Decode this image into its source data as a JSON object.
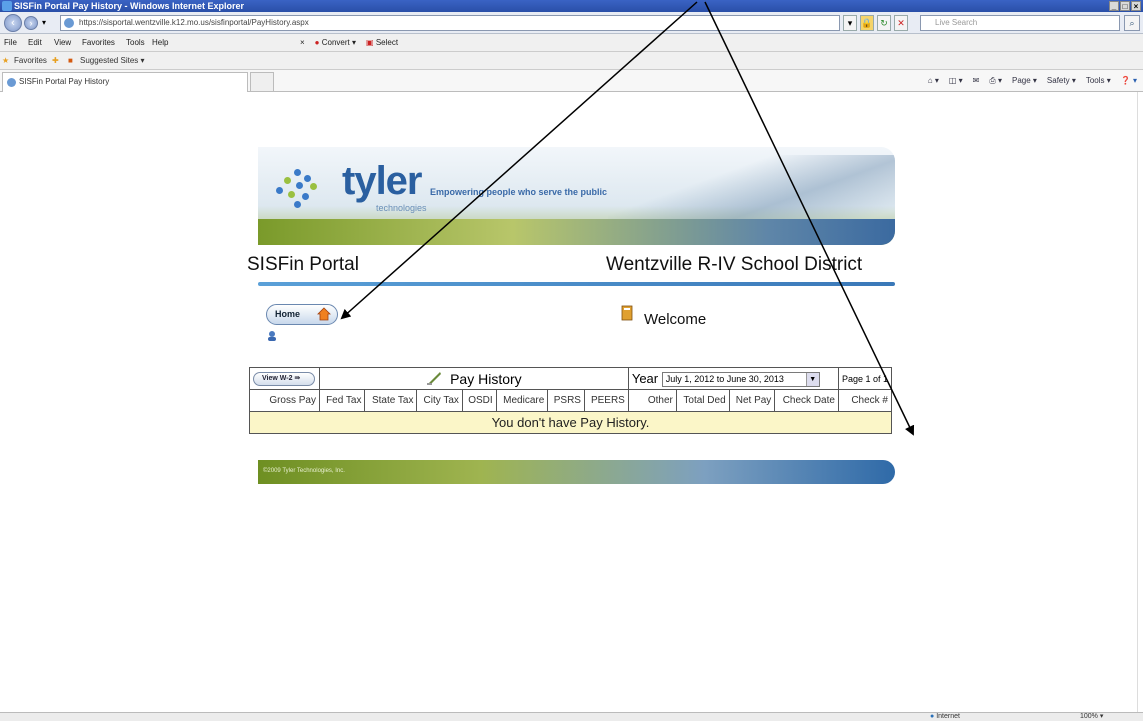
{
  "window": {
    "title": "SISFin Portal Pay History - Windows Internet Explorer",
    "url": "https://sisportal.wentzville.k12.mo.us/sisfinportal/PayHistory.aspx",
    "search_placeholder": "Live Search"
  },
  "menu": {
    "items": [
      "File",
      "Edit",
      "View",
      "Favorites",
      "Tools",
      "Help"
    ],
    "convert": "Convert",
    "select": "Select"
  },
  "favorites": {
    "label": "Favorites",
    "suggested": "Suggested Sites"
  },
  "tab": {
    "label": "SISFin Portal Pay History"
  },
  "commandbar": {
    "page": "Page",
    "safety": "Safety",
    "tools": "Tools"
  },
  "banner": {
    "logo": "tyler",
    "logo_sub": "technologies",
    "tagline": "Empowering people who serve the public"
  },
  "header": {
    "portal_title": "SISFin Portal",
    "district": "Wentzville R-IV School District"
  },
  "nav": {
    "home": "Home",
    "welcome": "Welcome"
  },
  "pay_history": {
    "view_w2": "View W-2",
    "title": "Pay History",
    "year_label": "Year",
    "year_value": "July 1, 2012 to June 30, 2013",
    "page_info": "Page 1 of 1",
    "columns": [
      "Gross Pay",
      "Fed Tax",
      "State Tax",
      "City Tax",
      "OSDI",
      "Medicare",
      "PSRS",
      "PEERS",
      "Other",
      "Total Ded",
      "Net Pay",
      "Check Date",
      "Check #"
    ],
    "empty_message": "You don't have Pay History."
  },
  "footer": {
    "copyright": "©2009 Tyler Technologies, Inc."
  },
  "status": {
    "zone": "Internet",
    "zoom": "100%"
  }
}
